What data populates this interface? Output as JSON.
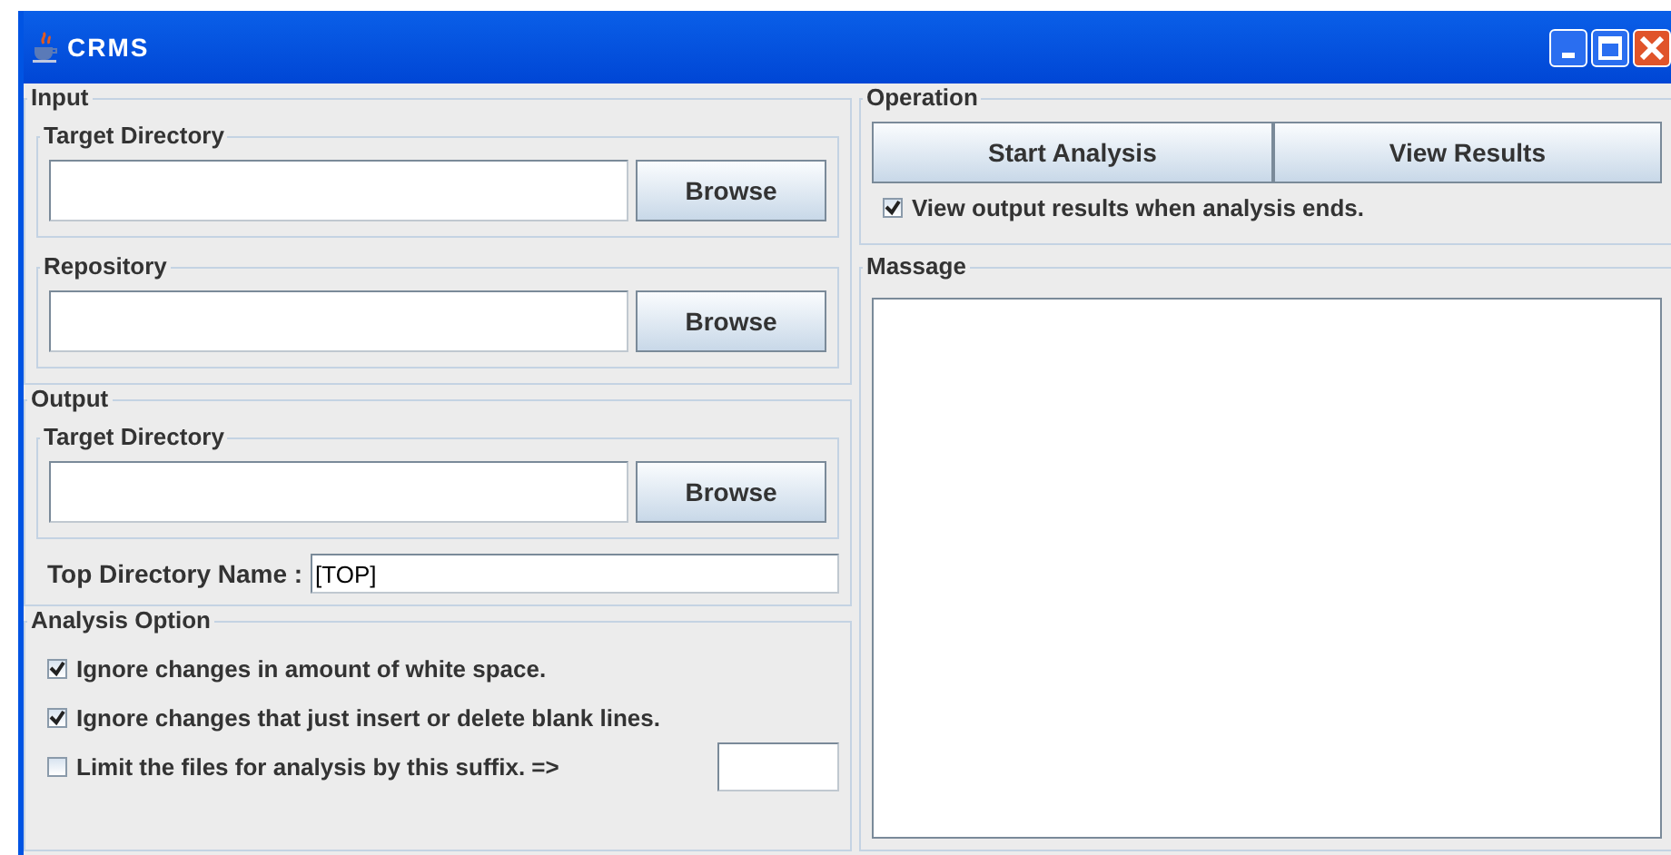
{
  "window": {
    "title": "CRMS"
  },
  "input": {
    "title": "Input",
    "sections": [
      {
        "title": "Target Directory",
        "button": "Browse"
      },
      {
        "title": "Repository",
        "button": "Browse"
      }
    ]
  },
  "output": {
    "title": "Output",
    "sections": [
      {
        "title": "Target Directory",
        "button": "Browse"
      }
    ],
    "top_directory_label": "Top Directory Name :",
    "top_directory_value": "[TOP]"
  },
  "analysis_option": {
    "title": "Analysis Option",
    "options": [
      {
        "kind": "checkbox",
        "label": "Ignore changes in amount of white space.",
        "checked": true
      },
      {
        "kind": "checkbox",
        "label": "Ignore changes that just insert or delete blank lines.",
        "checked": true
      },
      {
        "kind": "checkbox-with-field",
        "label": "Limit the files for analysis by this suffix. =>",
        "checked": false
      }
    ]
  },
  "operation": {
    "title": "Operation",
    "buttons": [
      "Start Analysis",
      "View Results"
    ],
    "option": {
      "label": "View output results when analysis ends.",
      "checked": true
    }
  },
  "message": {
    "title": "Massage"
  }
}
